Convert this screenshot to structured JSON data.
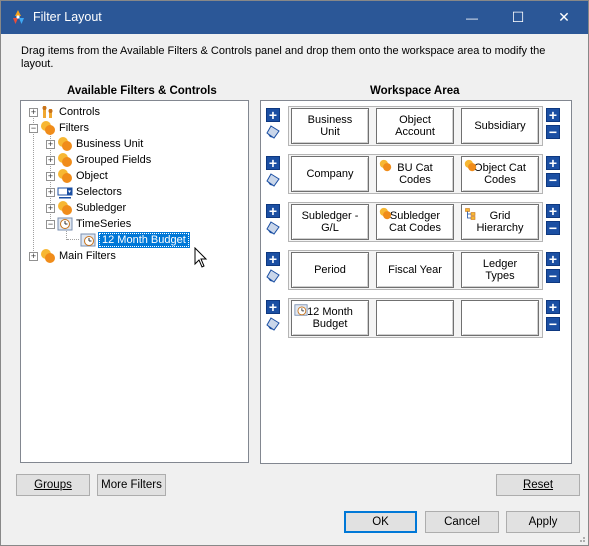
{
  "window": {
    "title": "Filter Layout",
    "minimize_glyph": "—",
    "maximize_glyph": "☐",
    "close_glyph": "✕",
    "titlebar_color": "#2b5797"
  },
  "instructions": "Drag items from the Available Filters & Controls panel and drop them onto the workspace area to modify the layout.",
  "left_panel": {
    "header": "Available Filters & Controls",
    "tree": [
      {
        "label": "Controls",
        "icon": "controls-icon",
        "expander": "+"
      },
      {
        "label": "Filters",
        "icon": "filter-folder-icon",
        "expander": "−"
      },
      {
        "label": "Business Unit",
        "icon": "filter-folder-icon",
        "expander": "+"
      },
      {
        "label": "Grouped Fields",
        "icon": "filter-folder-icon",
        "expander": "+"
      },
      {
        "label": "Object",
        "icon": "filter-folder-icon",
        "expander": "+"
      },
      {
        "label": "Selectors",
        "icon": "selector-icon",
        "expander": "+"
      },
      {
        "label": "Subledger",
        "icon": "filter-folder-icon",
        "expander": "+"
      },
      {
        "label": "TimeSeries",
        "icon": "timeseries-icon",
        "expander": "−"
      },
      {
        "label": "12 Month Budget",
        "icon": "calendar-icon",
        "selected": true
      },
      {
        "label": "Main Filters",
        "icon": "filter-folder-icon",
        "expander": "+"
      }
    ]
  },
  "workspace": {
    "header": "Workspace Area",
    "rows": [
      {
        "cells": [
          {
            "label": "Business\nUnit"
          },
          {
            "label": "Object\nAccount"
          },
          {
            "label": "Subsidiary"
          }
        ]
      },
      {
        "cells": [
          {
            "label": "Company"
          },
          {
            "label": "BU Cat\nCodes",
            "icon": "filter-icon"
          },
          {
            "label": "Object Cat\nCodes",
            "icon": "filter-icon"
          }
        ]
      },
      {
        "cells": [
          {
            "label": "Subledger -\nG/L"
          },
          {
            "label": "Subledger\nCat Codes",
            "icon": "filter-icon"
          },
          {
            "label": "Grid\nHierarchy",
            "icon": "hierarchy-icon"
          }
        ]
      },
      {
        "cells": [
          {
            "label": "Period"
          },
          {
            "label": "Fiscal Year"
          },
          {
            "label": "Ledger\nTypes"
          }
        ]
      },
      {
        "cells": [
          {
            "label": "12 Month\nBudget",
            "icon": "calendar-icon"
          },
          {
            "label": ""
          },
          {
            "label": ""
          }
        ]
      }
    ]
  },
  "buttons": {
    "groups": "Groups",
    "more_filters": "More Filters",
    "reset": "Reset",
    "ok": "OK",
    "cancel": "Cancel",
    "apply": "Apply"
  }
}
